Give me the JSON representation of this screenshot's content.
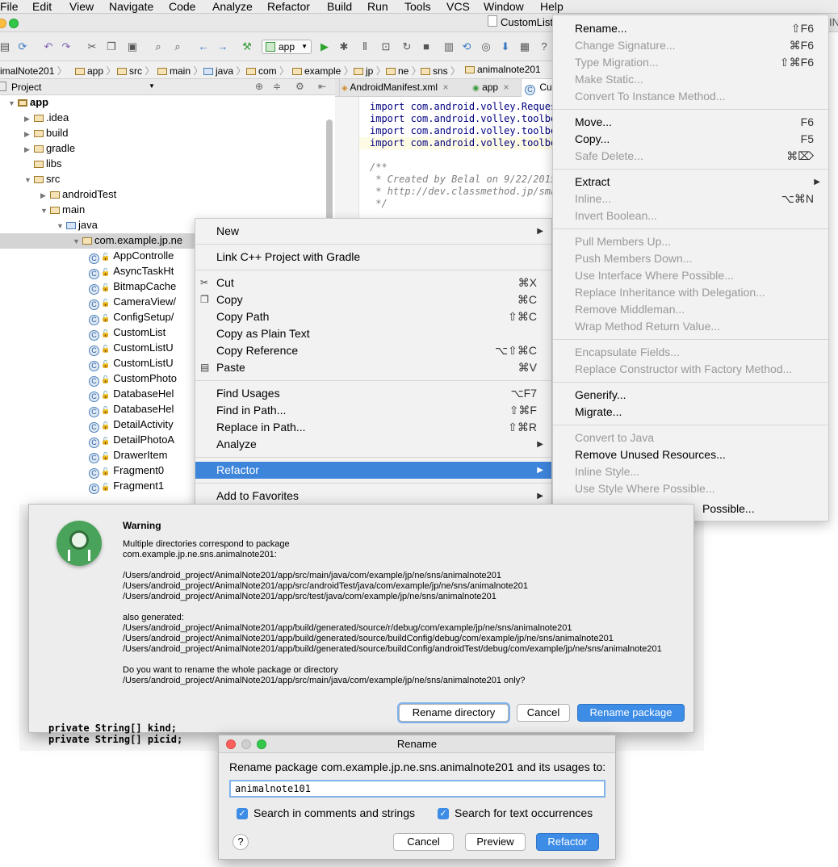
{
  "menubar": {
    "items": [
      "File",
      "Edit",
      "View",
      "Navigate",
      "Code",
      "Analyze",
      "Refactor",
      "Build",
      "Run",
      "Tools",
      "VCS",
      "Window",
      "Help"
    ]
  },
  "title_row": {
    "file": "CustomList",
    "tail": "IN"
  },
  "toolbar": {
    "run_config": "app"
  },
  "navbar": {
    "crumbs": [
      "imalNote201",
      "app",
      "src",
      "main",
      "java",
      "com",
      "example",
      "jp",
      "ne",
      "sns",
      "animalnote201"
    ]
  },
  "project_panel": {
    "header": "Project",
    "tree": [
      {
        "label": "app",
        "depth": 0,
        "expanded": true,
        "kind": "module"
      },
      {
        "label": ".idea",
        "depth": 1,
        "expanded": false,
        "kind": "folder"
      },
      {
        "label": "build",
        "depth": 1,
        "expanded": false,
        "kind": "folder"
      },
      {
        "label": "gradle",
        "depth": 1,
        "expanded": false,
        "kind": "folder"
      },
      {
        "label": "libs",
        "depth": 1,
        "kind": "folder"
      },
      {
        "label": "src",
        "depth": 1,
        "expanded": true,
        "kind": "folder"
      },
      {
        "label": "androidTest",
        "depth": 2,
        "expanded": false,
        "kind": "folder"
      },
      {
        "label": "main",
        "depth": 2,
        "expanded": true,
        "kind": "folder"
      },
      {
        "label": "java",
        "depth": 3,
        "expanded": true,
        "kind": "srcfolder"
      },
      {
        "label": "com.example.jp.ne",
        "depth": 4,
        "expanded": true,
        "kind": "package",
        "selected": true
      },
      {
        "label": "AppControlle",
        "depth": 5,
        "kind": "class"
      },
      {
        "label": "AsyncTaskHt",
        "depth": 5,
        "kind": "class"
      },
      {
        "label": "BitmapCache",
        "depth": 5,
        "kind": "class"
      },
      {
        "label": "CameraView/",
        "depth": 5,
        "kind": "class"
      },
      {
        "label": "ConfigSetup/",
        "depth": 5,
        "kind": "class"
      },
      {
        "label": "CustomList",
        "depth": 5,
        "kind": "class"
      },
      {
        "label": "CustomListU",
        "depth": 5,
        "kind": "class"
      },
      {
        "label": "CustomListU",
        "depth": 5,
        "kind": "class"
      },
      {
        "label": "CustomPhoto",
        "depth": 5,
        "kind": "class"
      },
      {
        "label": "DatabaseHel",
        "depth": 5,
        "kind": "class"
      },
      {
        "label": "DatabaseHel",
        "depth": 5,
        "kind": "class"
      },
      {
        "label": "DetailActivity",
        "depth": 5,
        "kind": "class"
      },
      {
        "label": "DetailPhotoA",
        "depth": 5,
        "kind": "class"
      },
      {
        "label": "DrawerItem",
        "depth": 5,
        "kind": "class"
      },
      {
        "label": "Fragment0",
        "depth": 5,
        "kind": "class"
      },
      {
        "label": "Fragment1",
        "depth": 5,
        "kind": "class"
      }
    ]
  },
  "editor_tabs": [
    "AndroidManifest.xml",
    "app",
    "Cu"
  ],
  "editor_code": [
    "import com.android.volley.Reques",
    "import com.android.volley.toolbo",
    "import com.android.volley.toolbo",
    "import com.android.volley.toolbo",
    "",
    "/**",
    " * Created by Belal on 9/22/2015",
    " * http://dev.classmethod.jp/sma",
    " */"
  ],
  "context_menu": {
    "items": [
      {
        "label": "New",
        "submenu": true
      },
      {
        "sep": true
      },
      {
        "label": "Link C++ Project with Gradle"
      },
      {
        "sep": true
      },
      {
        "label": "Cut",
        "shortcut": "⌘X",
        "icon": "scissors-icon"
      },
      {
        "label": "Copy",
        "shortcut": "⌘C",
        "icon": "copy-icon"
      },
      {
        "label": "Copy Path",
        "shortcut": "⇧⌘C"
      },
      {
        "label": "Copy as Plain Text"
      },
      {
        "label": "Copy Reference",
        "shortcut": "⌥⇧⌘C"
      },
      {
        "label": "Paste",
        "shortcut": "⌘V",
        "icon": "paste-icon"
      },
      {
        "sep": true
      },
      {
        "label": "Find Usages",
        "shortcut": "⌥F7"
      },
      {
        "label": "Find in Path...",
        "shortcut": "⇧⌘F"
      },
      {
        "label": "Replace in Path...",
        "shortcut": "⇧⌘R"
      },
      {
        "label": "Analyze",
        "submenu": true
      },
      {
        "sep": true
      },
      {
        "label": "Refactor",
        "submenu": true,
        "highlighted": true
      },
      {
        "sep": true
      },
      {
        "label": "Add to Favorites",
        "submenu": true
      }
    ]
  },
  "refactor_menu": {
    "items": [
      {
        "label": "Rename...",
        "shortcut": "⇧F6"
      },
      {
        "label": "Change Signature...",
        "shortcut": "⌘F6",
        "disabled": true
      },
      {
        "label": "Type Migration...",
        "shortcut": "⇧⌘F6",
        "disabled": true
      },
      {
        "label": "Make Static...",
        "disabled": true
      },
      {
        "label": "Convert To Instance Method...",
        "disabled": true
      },
      {
        "sep": true
      },
      {
        "label": "Move...",
        "shortcut": "F6"
      },
      {
        "label": "Copy...",
        "shortcut": "F5"
      },
      {
        "label": "Safe Delete...",
        "shortcut": "⌘⌦",
        "disabled": true
      },
      {
        "sep": true
      },
      {
        "label": "Extract",
        "submenu": true
      },
      {
        "label": "Inline...",
        "shortcut": "⌥⌘N",
        "disabled": true
      },
      {
        "label": "Invert Boolean...",
        "disabled": true
      },
      {
        "sep": true
      },
      {
        "label": "Pull Members Up...",
        "disabled": true
      },
      {
        "label": "Push Members Down...",
        "disabled": true
      },
      {
        "label": "Use Interface Where Possible...",
        "disabled": true
      },
      {
        "label": "Replace Inheritance with Delegation...",
        "disabled": true
      },
      {
        "label": "Remove Middleman...",
        "disabled": true
      },
      {
        "label": "Wrap Method Return Value...",
        "disabled": true
      },
      {
        "sep": true
      },
      {
        "label": "Encapsulate Fields...",
        "disabled": true
      },
      {
        "label": "Replace Constructor with Factory Method...",
        "disabled": true
      },
      {
        "sep": true
      },
      {
        "label": "Generify..."
      },
      {
        "label": "Migrate..."
      },
      {
        "sep": true
      },
      {
        "label": "Convert to Java",
        "disabled": true
      },
      {
        "label": "Remove Unused Resources..."
      },
      {
        "label": "Inline Style...",
        "disabled": true
      },
      {
        "label": "Use Style Where Possible...",
        "disabled": true
      }
    ],
    "overflow_fragment": "Possible..."
  },
  "warning_dialog": {
    "title": "Warning",
    "message1": "Multiple directories correspond to package",
    "message2": "com.example.jp.ne.sns.animalnote201:",
    "dirs": [
      "/Users/android_project/AnimalNote201/app/src/main/java/com/example/jp/ne/sns/animalnote201",
      "/Users/android_project/AnimalNote201/app/src/androidTest/java/com/example/jp/ne/sns/animalnote201",
      "/Users/android_project/AnimalNote201/app/src/test/java/com/example/jp/ne/sns/animalnote201"
    ],
    "also_generated": "also generated:",
    "generated": [
      "/Users/android_project/AnimalNote201/app/build/generated/source/r/debug/com/example/jp/ne/sns/animalnote201",
      "/Users/android_project/AnimalNote201/app/build/generated/source/buildConfig/debug/com/example/jp/ne/sns/animalnote201",
      "/Users/android_project/AnimalNote201/app/build/generated/source/buildConfig/androidTest/debug/com/example/jp/ne/sns/animalnote201"
    ],
    "question1": "Do you want to rename the whole package or directory",
    "question2": "/Users/android_project/AnimalNote201/app/src/main/java/com/example/jp/ne/sns/animalnote201 only?",
    "btn_rename_directory": "Rename directory",
    "btn_cancel": "Cancel",
    "btn_rename_package": "Rename package"
  },
  "rename_dialog": {
    "title": "Rename",
    "prompt": "Rename package com.example.jp.ne.sns.animalnote201 and its usages to:",
    "value": "animalnote101",
    "chk_comments": "Search in comments and strings",
    "chk_text": "Search for text occurrences",
    "help": "?",
    "btn_cancel": "Cancel",
    "btn_preview": "Preview",
    "btn_refactor": "Refactor"
  },
  "background_code": [
    "private String[] kind;",
    "private String[] picid;"
  ],
  "colors": {
    "accent": "#3d84db",
    "primary_button": "#3d8ce6",
    "folder": "#f5e3b5"
  }
}
